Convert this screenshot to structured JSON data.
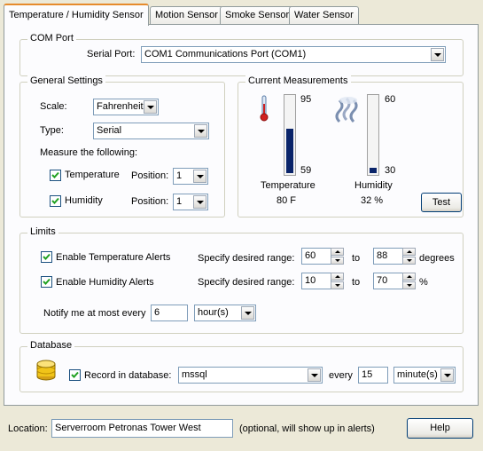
{
  "tabs": [
    "Temperature / Humidity Sensor",
    "Motion Sensor",
    "Smoke Sensor",
    "Water Sensor"
  ],
  "com_port": {
    "title": "COM Port",
    "serial_port_label": "Serial Port:",
    "serial_port_value": "COM1 Communications Port (COM1)"
  },
  "general": {
    "title": "General Settings",
    "scale_label": "Scale:",
    "scale_value": "Fahrenheit",
    "type_label": "Type:",
    "type_value": "Serial",
    "measure_label": "Measure the following:",
    "temperature_label": "Temperature",
    "humidity_label": "Humidity",
    "position_label": "Position:",
    "temperature_position": "1",
    "humidity_position": "1",
    "temperature_checked": true,
    "humidity_checked": true
  },
  "measurements": {
    "title": "Current Measurements",
    "temp_max": "95",
    "temp_min": "59",
    "temp_level": 0.58,
    "temperature_label": "Temperature",
    "temperature_value": "80 F",
    "hum_max": "60",
    "hum_min": "30",
    "hum_level": 0.07,
    "humidity_label": "Humidity",
    "humidity_value": "32 %",
    "test_button": "Test"
  },
  "limits": {
    "title": "Limits",
    "enable_temp_alerts": "Enable Temperature Alerts",
    "enable_hum_alerts": "Enable Humidity Alerts",
    "range_label": "Specify desired range:",
    "to_label": "to",
    "temp_min": "60",
    "temp_max": "88",
    "temp_unit": "degrees",
    "hum_min": "10",
    "hum_max": "70",
    "hum_unit": "%",
    "notify_label": "Notify me at most every",
    "notify_value": "6",
    "notify_unit": "hour(s)"
  },
  "database": {
    "title": "Database",
    "record_label": "Record in database:",
    "db_value": "mssql",
    "every_label": "every",
    "every_value": "15",
    "every_unit": "minute(s)"
  },
  "footer": {
    "location_label": "Location:",
    "location_value": "Serverroom Petronas Tower West",
    "location_hint": "(optional, will show up in alerts)",
    "help_button": "Help"
  },
  "colors": {
    "accent_tab": "#e68b2c",
    "gauge_fill": "#0a246a",
    "db_icon": "#f0c419"
  }
}
